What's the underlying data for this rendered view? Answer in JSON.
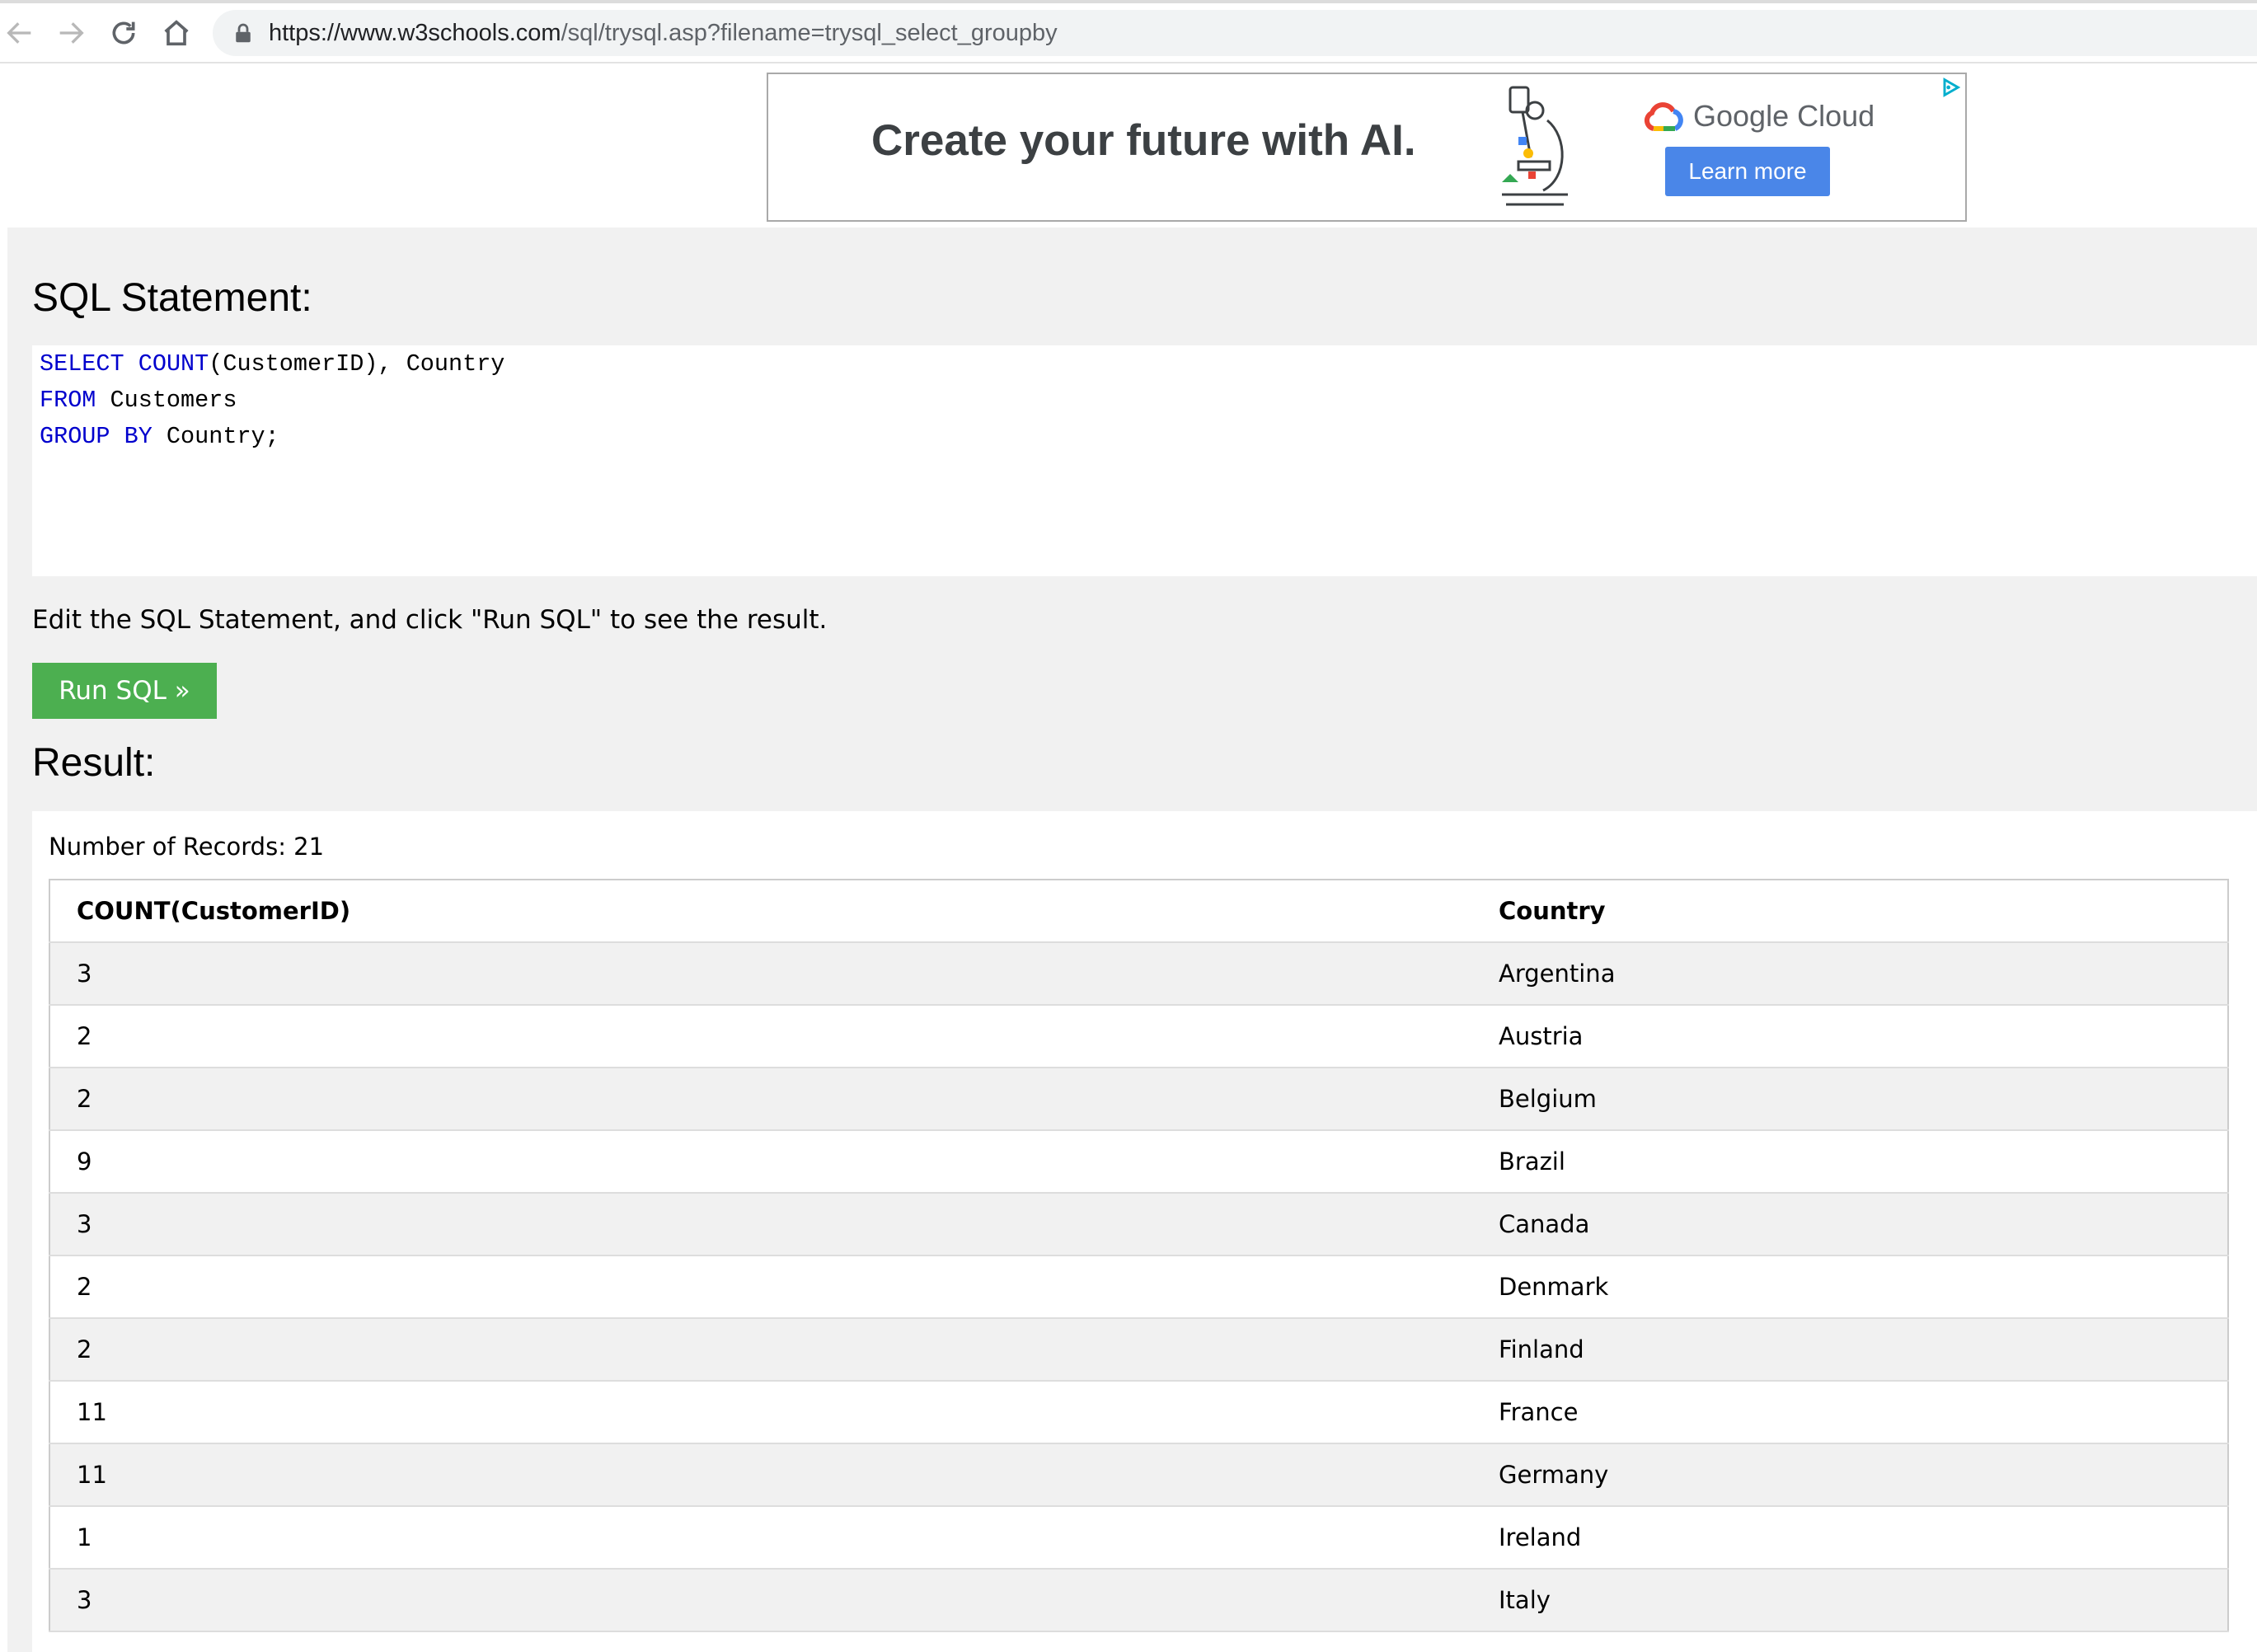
{
  "browser": {
    "url_host": "https://www.w3schools.com",
    "url_path": "/sql/trysql.asp?filename=trysql_select_groupby"
  },
  "ad": {
    "headline": "Create your future with AI.",
    "brand": "Google Cloud",
    "button": "Learn more",
    "brand_colors": [
      "#ea4335",
      "#fbbc05",
      "#34a853",
      "#4285f4"
    ]
  },
  "sql": {
    "heading": "SQL Statement:",
    "lines": [
      [
        {
          "t": "SELECT",
          "kw": true
        },
        {
          "t": " ",
          "kw": false
        },
        {
          "t": "COUNT",
          "kw": true
        },
        {
          "t": "(CustomerID), Country",
          "kw": false
        }
      ],
      [
        {
          "t": "FROM",
          "kw": true
        },
        {
          "t": " Customers",
          "kw": false
        }
      ],
      [
        {
          "t": "GROUP BY",
          "kw": true
        },
        {
          "t": " Country;",
          "kw": false
        }
      ]
    ],
    "hint": "Edit the SQL Statement, and click \"Run SQL\" to see the result.",
    "run_button": "Run SQL »"
  },
  "result": {
    "heading": "Result:",
    "records_label": "Number of Records: 21",
    "columns": [
      "COUNT(CustomerID)",
      "Country"
    ],
    "rows": [
      [
        "3",
        "Argentina"
      ],
      [
        "2",
        "Austria"
      ],
      [
        "2",
        "Belgium"
      ],
      [
        "9",
        "Brazil"
      ],
      [
        "3",
        "Canada"
      ],
      [
        "2",
        "Denmark"
      ],
      [
        "2",
        "Finland"
      ],
      [
        "11",
        "France"
      ],
      [
        "11",
        "Germany"
      ],
      [
        "1",
        "Ireland"
      ],
      [
        "3",
        "Italy"
      ]
    ]
  },
  "colors": {
    "keyword": "#0000cd",
    "run_button": "#4caf50",
    "panel_bg": "#f1f1f1"
  }
}
